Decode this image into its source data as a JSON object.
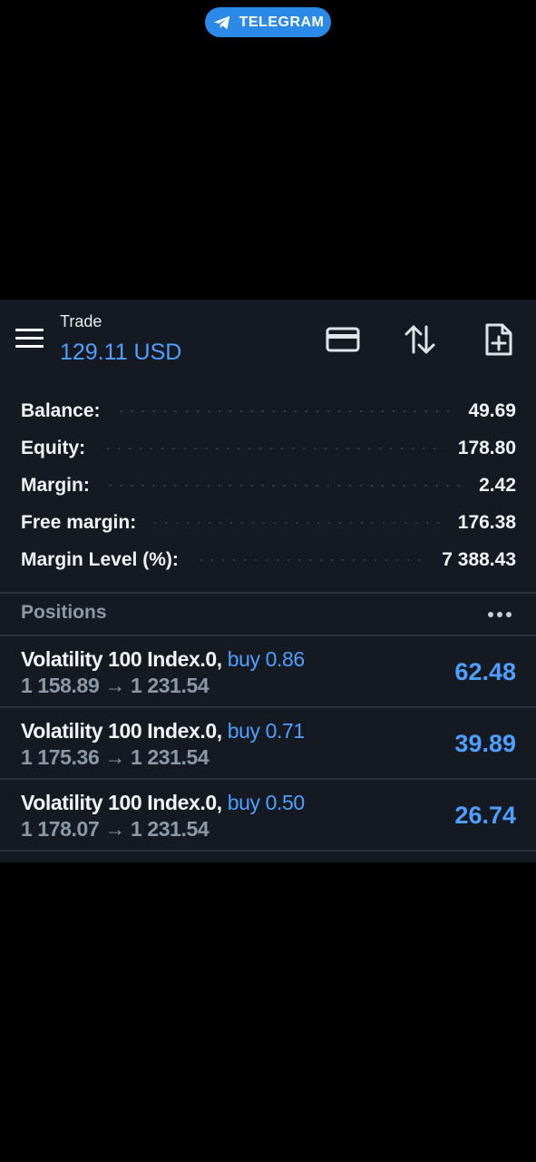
{
  "telegram": {
    "label": "TELEGRAM",
    "icon": "telegram-plane-icon",
    "color": "#2b8ae8"
  },
  "header": {
    "title": "Trade",
    "equity_value": "129.11 USD",
    "icons": [
      "menu-icon",
      "card-icon",
      "sort-icon",
      "new-order-icon"
    ]
  },
  "summary": [
    {
      "label": "Balance:",
      "value": "49.69"
    },
    {
      "label": "Equity:",
      "value": "178.80"
    },
    {
      "label": "Margin:",
      "value": "2.42"
    },
    {
      "label": "Free margin:",
      "value": "176.38"
    },
    {
      "label": "Margin Level (%):",
      "value": "7 388.43"
    }
  ],
  "positions": {
    "header": "Positions",
    "items": [
      {
        "symbol": "Volatility 100 Index.0,",
        "side": "buy 0.86",
        "open": "1 158.89",
        "arrow": "→",
        "current": "1 231.54",
        "profit": "62.48"
      },
      {
        "symbol": "Volatility 100 Index.0,",
        "side": "buy 0.71",
        "open": "1 175.36",
        "arrow": "→",
        "current": "1 231.54",
        "profit": "39.89"
      },
      {
        "symbol": "Volatility 100 Index.0,",
        "side": "buy 0.50",
        "open": "1 178.07",
        "arrow": "→",
        "current": "1 231.54",
        "profit": "26.74"
      }
    ]
  },
  "colors": {
    "accent": "#4e9fff",
    "panel": "#151a22",
    "muted": "#8a98a8"
  }
}
